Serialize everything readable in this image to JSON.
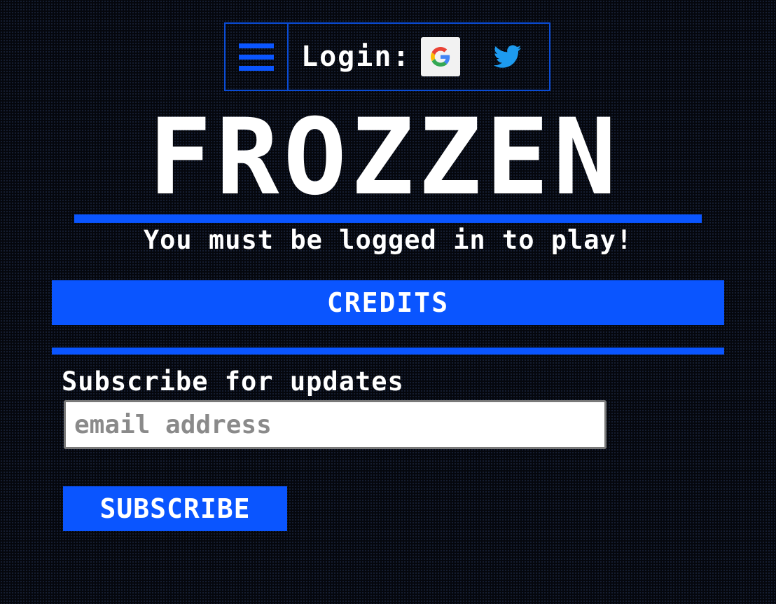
{
  "header": {
    "login_label": "Login:",
    "google_icon": "google-icon",
    "twitter_icon": "twitter-icon",
    "menu_icon": "hamburger-menu-icon"
  },
  "main": {
    "title": "FROZZEN",
    "notice": "You must be logged in to play!",
    "credits_label": "CREDITS"
  },
  "subscribe": {
    "heading": "Subscribe for updates",
    "email_value": "",
    "email_placeholder": "email address",
    "button_label": "SUBSCRIBE"
  },
  "colors": {
    "background": "#05070d",
    "accent": "#0a55ff",
    "border": "#0a4cd6",
    "text": "#ffffff",
    "twitter": "#1d9bf0"
  }
}
